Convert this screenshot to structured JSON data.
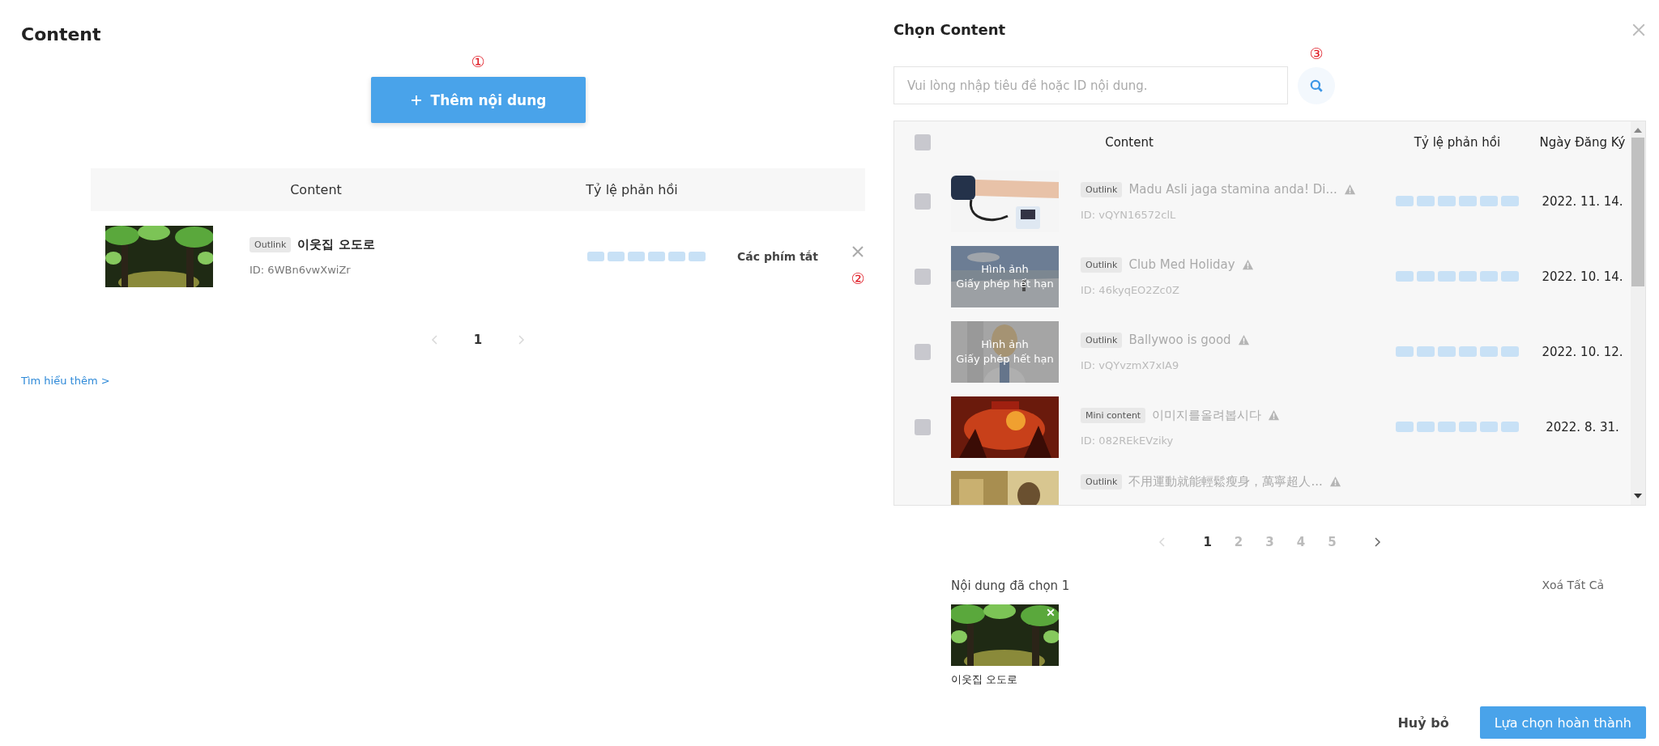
{
  "left": {
    "title": "Content",
    "add_button": {
      "label": "Thêm nội dung",
      "marker": "①"
    },
    "table": {
      "columns": [
        "Content",
        "Tỷ lệ phản hồi"
      ],
      "rows": [
        {
          "badge": "Outlink",
          "title": "이웃집 오도로",
          "id": "ID: 6WBn6vwXwiZr",
          "shortcut": "Các phím tắt",
          "marker": "②"
        }
      ]
    },
    "pagination": {
      "prev_disabled": true,
      "next_disabled": true,
      "pages": [
        {
          "label": "1",
          "selected": true
        }
      ]
    },
    "link": "Tìm hiểu thêm >"
  },
  "right": {
    "title": "Chọn Content",
    "search": {
      "placeholder": "Vui lòng nhập tiêu đề hoặc ID nội dung.",
      "marker": "③"
    },
    "table": {
      "columns": [
        "Content",
        "Tỷ lệ phản hồi",
        "Ngày Đăng Ký"
      ],
      "header_checked": false,
      "rows": [
        {
          "checked": false,
          "disabled": true,
          "warning": true,
          "badge": "Outlink",
          "title": "Madu Asli jaga stamina anda! Di...",
          "id": "ID: vQYN16572clL",
          "date": "2022. 11. 14."
        },
        {
          "checked": false,
          "disabled": true,
          "warning": true,
          "badge": "Outlink",
          "title": "Club Med Holiday",
          "id": "ID: 46kyqEO2Zc0Z",
          "date": "2022. 10. 14.",
          "overlay": [
            "Hình ảnh",
            "Giấy phép hết hạn"
          ]
        },
        {
          "checked": false,
          "disabled": true,
          "warning": true,
          "badge": "Outlink",
          "title": "Ballywoo is good",
          "id": "ID: vQYvzmX7xIA9",
          "date": "2022. 10. 12.",
          "overlay": [
            "Hình ảnh",
            "Giấy phép hết hạn"
          ]
        },
        {
          "checked": false,
          "disabled": true,
          "warning": true,
          "badge": "Mini content",
          "title": "이미지를올려봅시다",
          "id": "ID: 082REkEVziky",
          "date": "2022. 8. 31."
        },
        {
          "disabled": true,
          "warning": true,
          "badge": "Outlink",
          "title": "不用運動就能輕鬆瘦身，萬寧超人..."
        }
      ]
    },
    "pagination": {
      "prev_disabled": true,
      "next_disabled": false,
      "pages": [
        {
          "label": "1",
          "selected": true
        },
        {
          "label": "2",
          "selected": false
        },
        {
          "label": "3",
          "selected": false
        },
        {
          "label": "4",
          "selected": false
        },
        {
          "label": "5",
          "selected": false
        }
      ]
    },
    "selected": {
      "label": "Nội dung đã chọn 1",
      "clear": "Xoá Tất Cả",
      "items": [
        {
          "title": "이웃집 오도로"
        }
      ]
    },
    "buttons": {
      "cancel": "Huỷ bỏ",
      "confirm": "Lựa chọn hoàn thành"
    }
  }
}
